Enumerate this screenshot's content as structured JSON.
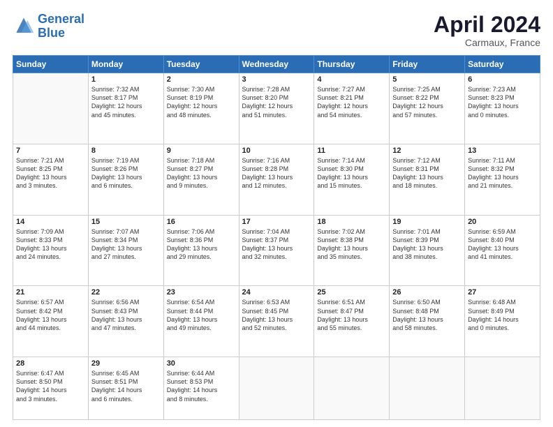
{
  "header": {
    "logo_line1": "General",
    "logo_line2": "Blue",
    "month_title": "April 2024",
    "location": "Carmaux, France"
  },
  "days_of_week": [
    "Sunday",
    "Monday",
    "Tuesday",
    "Wednesday",
    "Thursday",
    "Friday",
    "Saturday"
  ],
  "weeks": [
    [
      {
        "num": "",
        "info": ""
      },
      {
        "num": "1",
        "info": "Sunrise: 7:32 AM\nSunset: 8:17 PM\nDaylight: 12 hours\nand 45 minutes."
      },
      {
        "num": "2",
        "info": "Sunrise: 7:30 AM\nSunset: 8:19 PM\nDaylight: 12 hours\nand 48 minutes."
      },
      {
        "num": "3",
        "info": "Sunrise: 7:28 AM\nSunset: 8:20 PM\nDaylight: 12 hours\nand 51 minutes."
      },
      {
        "num": "4",
        "info": "Sunrise: 7:27 AM\nSunset: 8:21 PM\nDaylight: 12 hours\nand 54 minutes."
      },
      {
        "num": "5",
        "info": "Sunrise: 7:25 AM\nSunset: 8:22 PM\nDaylight: 12 hours\nand 57 minutes."
      },
      {
        "num": "6",
        "info": "Sunrise: 7:23 AM\nSunset: 8:23 PM\nDaylight: 13 hours\nand 0 minutes."
      }
    ],
    [
      {
        "num": "7",
        "info": "Sunrise: 7:21 AM\nSunset: 8:25 PM\nDaylight: 13 hours\nand 3 minutes."
      },
      {
        "num": "8",
        "info": "Sunrise: 7:19 AM\nSunset: 8:26 PM\nDaylight: 13 hours\nand 6 minutes."
      },
      {
        "num": "9",
        "info": "Sunrise: 7:18 AM\nSunset: 8:27 PM\nDaylight: 13 hours\nand 9 minutes."
      },
      {
        "num": "10",
        "info": "Sunrise: 7:16 AM\nSunset: 8:28 PM\nDaylight: 13 hours\nand 12 minutes."
      },
      {
        "num": "11",
        "info": "Sunrise: 7:14 AM\nSunset: 8:30 PM\nDaylight: 13 hours\nand 15 minutes."
      },
      {
        "num": "12",
        "info": "Sunrise: 7:12 AM\nSunset: 8:31 PM\nDaylight: 13 hours\nand 18 minutes."
      },
      {
        "num": "13",
        "info": "Sunrise: 7:11 AM\nSunset: 8:32 PM\nDaylight: 13 hours\nand 21 minutes."
      }
    ],
    [
      {
        "num": "14",
        "info": "Sunrise: 7:09 AM\nSunset: 8:33 PM\nDaylight: 13 hours\nand 24 minutes."
      },
      {
        "num": "15",
        "info": "Sunrise: 7:07 AM\nSunset: 8:34 PM\nDaylight: 13 hours\nand 27 minutes."
      },
      {
        "num": "16",
        "info": "Sunrise: 7:06 AM\nSunset: 8:36 PM\nDaylight: 13 hours\nand 29 minutes."
      },
      {
        "num": "17",
        "info": "Sunrise: 7:04 AM\nSunset: 8:37 PM\nDaylight: 13 hours\nand 32 minutes."
      },
      {
        "num": "18",
        "info": "Sunrise: 7:02 AM\nSunset: 8:38 PM\nDaylight: 13 hours\nand 35 minutes."
      },
      {
        "num": "19",
        "info": "Sunrise: 7:01 AM\nSunset: 8:39 PM\nDaylight: 13 hours\nand 38 minutes."
      },
      {
        "num": "20",
        "info": "Sunrise: 6:59 AM\nSunset: 8:40 PM\nDaylight: 13 hours\nand 41 minutes."
      }
    ],
    [
      {
        "num": "21",
        "info": "Sunrise: 6:57 AM\nSunset: 8:42 PM\nDaylight: 13 hours\nand 44 minutes."
      },
      {
        "num": "22",
        "info": "Sunrise: 6:56 AM\nSunset: 8:43 PM\nDaylight: 13 hours\nand 47 minutes."
      },
      {
        "num": "23",
        "info": "Sunrise: 6:54 AM\nSunset: 8:44 PM\nDaylight: 13 hours\nand 49 minutes."
      },
      {
        "num": "24",
        "info": "Sunrise: 6:53 AM\nSunset: 8:45 PM\nDaylight: 13 hours\nand 52 minutes."
      },
      {
        "num": "25",
        "info": "Sunrise: 6:51 AM\nSunset: 8:47 PM\nDaylight: 13 hours\nand 55 minutes."
      },
      {
        "num": "26",
        "info": "Sunrise: 6:50 AM\nSunset: 8:48 PM\nDaylight: 13 hours\nand 58 minutes."
      },
      {
        "num": "27",
        "info": "Sunrise: 6:48 AM\nSunset: 8:49 PM\nDaylight: 14 hours\nand 0 minutes."
      }
    ],
    [
      {
        "num": "28",
        "info": "Sunrise: 6:47 AM\nSunset: 8:50 PM\nDaylight: 14 hours\nand 3 minutes."
      },
      {
        "num": "29",
        "info": "Sunrise: 6:45 AM\nSunset: 8:51 PM\nDaylight: 14 hours\nand 6 minutes."
      },
      {
        "num": "30",
        "info": "Sunrise: 6:44 AM\nSunset: 8:53 PM\nDaylight: 14 hours\nand 8 minutes."
      },
      {
        "num": "",
        "info": ""
      },
      {
        "num": "",
        "info": ""
      },
      {
        "num": "",
        "info": ""
      },
      {
        "num": "",
        "info": ""
      }
    ]
  ]
}
